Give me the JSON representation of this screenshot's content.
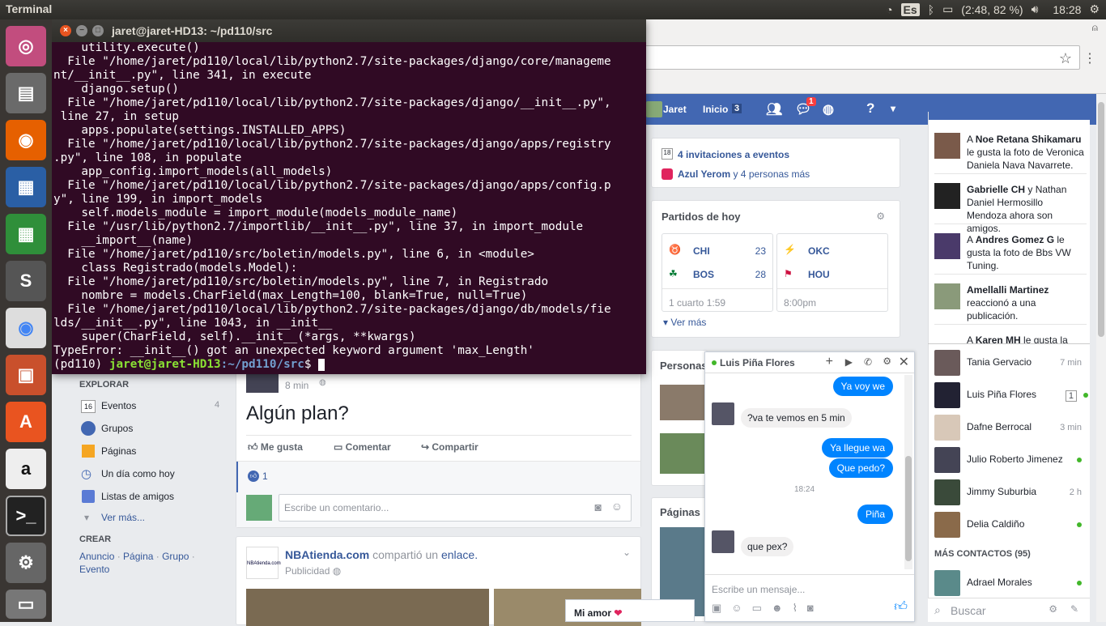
{
  "topbar": {
    "app": "Terminal",
    "kb": "Es",
    "battery": "(2:48, 82 %)",
    "time": "18:28"
  },
  "terminal": {
    "title": "jaret@jaret-HD13: ~/pd110/src",
    "lines": [
      "    utility.execute()",
      "  File \"/home/jaret/pd110/local/lib/python2.7/site-packages/django/core/manageme",
      "nt/__init__.py\", line 341, in execute",
      "    django.setup()",
      "  File \"/home/jaret/pd110/local/lib/python2.7/site-packages/django/__init__.py\",",
      " line 27, in setup",
      "    apps.populate(settings.INSTALLED_APPS)",
      "  File \"/home/jaret/pd110/local/lib/python2.7/site-packages/django/apps/registry",
      ".py\", line 108, in populate",
      "    app_config.import_models(all_models)",
      "  File \"/home/jaret/pd110/local/lib/python2.7/site-packages/django/apps/config.p",
      "y\", line 199, in import_models",
      "    self.models_module = import_module(models_module_name)",
      "  File \"/usr/lib/python2.7/importlib/__init__.py\", line 37, in import_module",
      "    __import__(name)",
      "  File \"/home/jaret/pd110/src/boletin/models.py\", line 6, in <module>",
      "    class Registrado(models.Model):",
      "  File \"/home/jaret/pd110/src/boletin/models.py\", line 7, in Registrado",
      "    nombre = models.CharField(max_Length=100, blank=True, null=True)",
      "  File \"/home/jaret/pd110/local/lib/python2.7/site-packages/django/db/models/fie",
      "lds/__init__.py\", line 1043, in __init__",
      "    super(CharField, self).__init__(*args, **kwargs)",
      "TypeError: __init__() got an unexpected keyword argument 'max_Length'"
    ],
    "prompt_env": "(pd110) ",
    "prompt_user": "jaret@jaret-HD13",
    "prompt_path": ":~/pd110/src",
    "prompt_end": "$ "
  },
  "fb": {
    "user": "Jaret",
    "home": "Inicio",
    "home_count": "3",
    "msg_badge": "1",
    "events": {
      "invites": "4 invitaciones a eventos",
      "person": "Azul Yerom",
      "rest": " y 4 personas más"
    },
    "games": {
      "title": "Partidos de hoy",
      "g1": {
        "t1": "CHI",
        "s1": "23",
        "t2": "BOS",
        "s2": "28",
        "status": "1 cuarto 1:59"
      },
      "g2": {
        "t1": "OKC",
        "t2": "HOU",
        "status": "8:00pm"
      },
      "more": "Ver más"
    },
    "people_title": "Personas",
    "pages_title": "Páginas",
    "left": {
      "explore": "EXPLORAR",
      "items": [
        {
          "icon": "16",
          "label": "Eventos",
          "count": "4"
        },
        {
          "label": "Grupos"
        },
        {
          "label": "Páginas"
        },
        {
          "label": "Un día como hoy"
        },
        {
          "label": "Listas de amigos"
        },
        {
          "label": "Ver más..."
        }
      ],
      "create": "CREAR",
      "create_links": [
        "Anuncio",
        "Página",
        "Grupo",
        "Evento"
      ]
    },
    "post": {
      "time": "8 min",
      "text": "Algún plan?",
      "like": "Me gusta",
      "comment": "Comentar",
      "share": "Compartir",
      "likes": "1",
      "comment_placeholder": "Escribe un comentario..."
    },
    "ad": {
      "name": "NBAtienda.com",
      "shared": " compartió un ",
      "link": "enlace.",
      "sponsored": "Publicidad",
      "logo": "NBAtienda.com"
    },
    "mi_amor": "Mi amor",
    "chat": {
      "name": "Luis Piña Flores",
      "msgs": {
        "m1": "Ya voy we",
        "m2": "?va te vemos en 5 min",
        "m3": "Ya llegue wa",
        "m4": "Que pedo?",
        "time": "18:24",
        "m5": "Piña",
        "m6": "que pex?"
      },
      "placeholder": "Escribe un mensaje..."
    },
    "ticker": [
      {
        "pre": "A ",
        "name": "Noe Retana Shikamaru",
        "rest": " le gusta la foto de Veronica Daniela Nava Navarrete."
      },
      {
        "pre": "",
        "name": "Gabrielle CH",
        "rest": " y Nathan Daniel Hermosillo Mendoza ahora son amigos."
      },
      {
        "pre": "A ",
        "name": "Andres Gomez G",
        "rest": " le gusta la foto de Bbs VW Tuning."
      },
      {
        "pre": "",
        "name": "Amellalli Martinez",
        "rest": " reaccionó a una publicación."
      },
      {
        "pre": "A ",
        "name": "Karen MH",
        "rest": " le gusta la foto"
      }
    ],
    "contacts": [
      {
        "name": "Tania Gervacio",
        "meta": "7 min"
      },
      {
        "name": "Luis Piña Flores",
        "meta": "1"
      },
      {
        "name": "Dafne Berrocal",
        "meta": "3 min"
      },
      {
        "name": "Julio Roberto Jimenez",
        "meta": ""
      },
      {
        "name": "Jimmy Suburbia",
        "meta": "2 h"
      },
      {
        "name": "Delia Caldiño",
        "meta": ""
      }
    ],
    "more_contacts": "MÁS CONTACTOS (95)",
    "more_list": [
      {
        "name": "Adrael Morales"
      }
    ],
    "search": "Buscar"
  }
}
